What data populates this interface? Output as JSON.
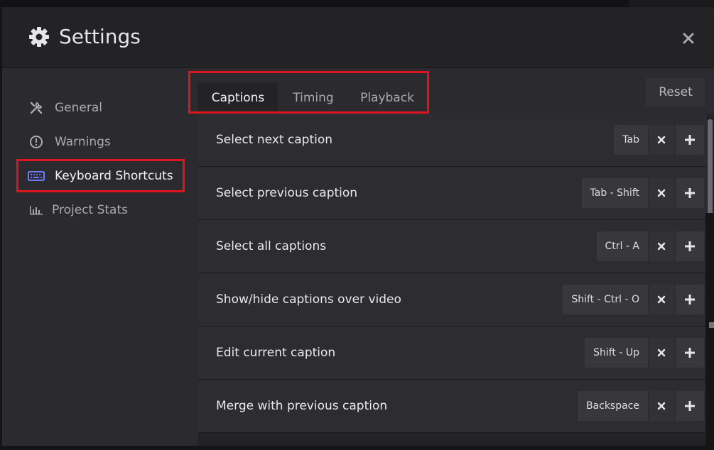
{
  "modal": {
    "title": "Settings",
    "header_icon": "gear-icon",
    "close_icon": "close-icon"
  },
  "sidebar": {
    "items": [
      {
        "label": "General",
        "icon": "tools-icon",
        "active": false
      },
      {
        "label": "Warnings",
        "icon": "warning-circle-icon",
        "active": false
      },
      {
        "label": "Keyboard Shortcuts",
        "icon": "keyboard-icon",
        "active": true
      },
      {
        "label": "Project Stats",
        "icon": "bar-chart-icon",
        "active": false
      }
    ]
  },
  "tabs": [
    {
      "label": "Captions",
      "active": true
    },
    {
      "label": "Timing",
      "active": false
    },
    {
      "label": "Playback",
      "active": false
    }
  ],
  "reset_label": "Reset",
  "shortcuts": [
    {
      "label": "Select next caption",
      "key": "Tab"
    },
    {
      "label": "Select previous caption",
      "key": "Tab - Shift"
    },
    {
      "label": "Select all captions",
      "key": "Ctrl - A"
    },
    {
      "label": "Show/hide captions over video",
      "key": "Shift - Ctrl - O"
    },
    {
      "label": "Edit current caption",
      "key": "Shift - Up"
    },
    {
      "label": "Merge with previous caption",
      "key": "Backspace"
    }
  ],
  "colors": {
    "highlight": "#e0141c",
    "keyboard_icon": "#6b7cff"
  }
}
